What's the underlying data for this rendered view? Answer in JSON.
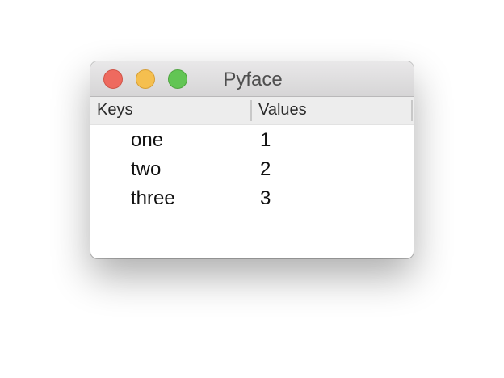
{
  "window": {
    "title": "Pyface"
  },
  "table": {
    "columns": [
      "Keys",
      "Values"
    ],
    "rows": [
      {
        "key": "one",
        "value": "1"
      },
      {
        "key": "two",
        "value": "2"
      },
      {
        "key": "three",
        "value": "3"
      }
    ]
  },
  "colors": {
    "close": "#ee6a5f",
    "minimize": "#f5bf4f",
    "zoom": "#62c554"
  }
}
